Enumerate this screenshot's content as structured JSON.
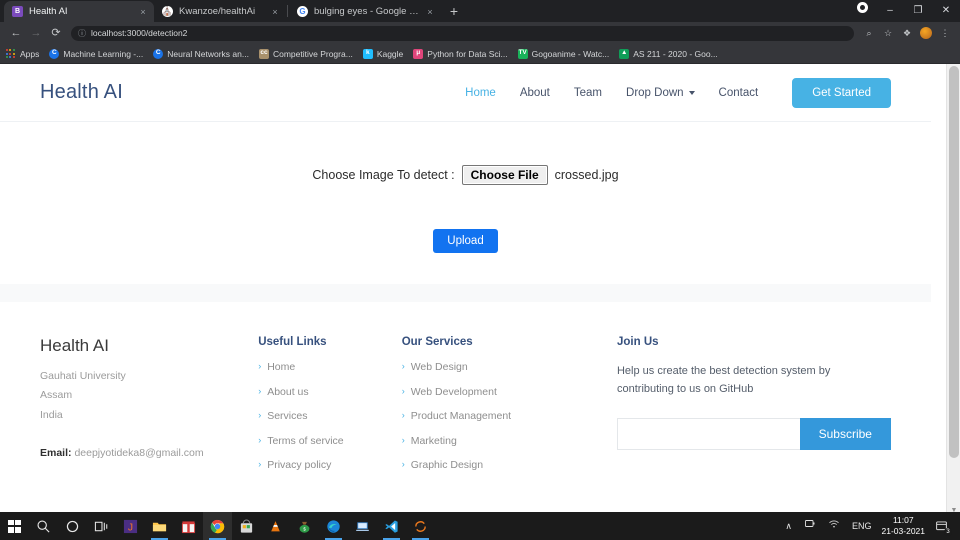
{
  "browser": {
    "tabs": [
      {
        "title": "Health AI",
        "favicon": "bing-icon",
        "active": true,
        "close_label": "×"
      },
      {
        "title": "Kwanzoe/healthAi",
        "favicon": "github-icon",
        "active": false,
        "close_label": "×"
      },
      {
        "title": "bulging eyes - Google Search",
        "favicon": "google-icon",
        "active": false,
        "close_label": "×"
      }
    ],
    "new_tab_label": "+",
    "window_controls": {
      "profile": "●",
      "minimize": "–",
      "maximize": "❐",
      "close": "✕"
    },
    "toolbar": {
      "back": "←",
      "forward": "→",
      "reload": "⟳",
      "url": "localhost:3000/detection2",
      "info_icon": "ⓘ",
      "search_icon": "⌕",
      "bookmark_icon": "☆",
      "extensions_icon": "❖",
      "menu_icon": "⋮"
    },
    "bookmarks": [
      {
        "label": "Apps",
        "icon": "apps-grid-icon"
      },
      {
        "label": "Machine Learning -...",
        "icon": "coursera-icon",
        "letter": "C"
      },
      {
        "label": "Neural Networks an...",
        "icon": "coursera-icon",
        "letter": "C"
      },
      {
        "label": "Competitive Progra...",
        "icon": "codechef-icon",
        "letter": "cc"
      },
      {
        "label": "Kaggle",
        "icon": "kaggle-icon",
        "letter": "k"
      },
      {
        "label": "Python for Data Sci...",
        "icon": "python-icon",
        "letter": "μ"
      },
      {
        "label": "Gogoanime - Watc...",
        "icon": "gogoanime-icon",
        "letter": "TV"
      },
      {
        "label": "AS 211 - 2020 - Goo...",
        "icon": "google-drive-icon",
        "letter": "▲"
      }
    ]
  },
  "site": {
    "brand": "Health AI",
    "nav": [
      {
        "label": "Home",
        "active": true
      },
      {
        "label": "About",
        "active": false
      },
      {
        "label": "Team",
        "active": false
      },
      {
        "label": "Drop Down",
        "active": false,
        "has_caret": true
      },
      {
        "label": "Contact",
        "active": false
      }
    ],
    "cta_label": "Get Started"
  },
  "main": {
    "file_label": "Choose Image To detect :",
    "choose_file_button": "Choose File",
    "file_name": "crossed.jpg",
    "upload_button": "Upload"
  },
  "footer": {
    "brand": "Health AI",
    "address": [
      "Gauhati University",
      "Assam",
      "India"
    ],
    "email_label": "Email:",
    "email_value": "deepjyotideka8@gmail.com",
    "useful_links": {
      "heading": "Useful Links",
      "items": [
        "Home",
        "About us",
        "Services",
        "Terms of service",
        "Privacy policy"
      ]
    },
    "our_services": {
      "heading": "Our Services",
      "items": [
        "Web Design",
        "Web Development",
        "Product Management",
        "Marketing",
        "Graphic Design"
      ]
    },
    "join_us": {
      "heading": "Join Us",
      "text": "Help us create the best detection system by contributing to us on GitHub",
      "input_value": "",
      "input_placeholder": "",
      "subscribe_button": "Subscribe"
    },
    "chevron": "›"
  },
  "taskbar": {
    "start": "windows-logo-icon",
    "items": [
      {
        "name": "search-icon",
        "glyph": "⌕"
      },
      {
        "name": "cortana-icon",
        "glyph": "○"
      },
      {
        "name": "task-view-icon",
        "glyph": "⌸"
      },
      {
        "name": "jupyter-icon",
        "glyph": "⬛",
        "open": false
      },
      {
        "name": "file-explorer-icon",
        "glyph": "὜1",
        "open": true
      },
      {
        "name": "gift-store-icon",
        "glyph": "Ἰ1",
        "open": false
      },
      {
        "name": "chrome-icon",
        "glyph": "◎",
        "open": true,
        "highlight": true
      },
      {
        "name": "microsoft-store-icon",
        "glyph": "Ὤd",
        "open": false
      },
      {
        "name": "vlc-icon",
        "glyph": "△",
        "open": false
      },
      {
        "name": "money-bag-icon",
        "glyph": "Ὃ0",
        "open": false
      },
      {
        "name": "edge-icon",
        "glyph": "◉",
        "open": true
      },
      {
        "name": "remote-desktop-icon",
        "glyph": "Ὃb",
        "open": false
      },
      {
        "name": "vscode-icon",
        "glyph": "⬢",
        "open": true
      },
      {
        "name": "spyder-icon",
        "glyph": "↻",
        "open": true
      }
    ],
    "tray": {
      "chevron_up": "∧",
      "battery_icon": "ὐb",
      "wifi_icon": "◡",
      "language": "ENG",
      "time": "11:07",
      "date": "21-03-2021",
      "notification_count": "3"
    }
  },
  "colors": {
    "accent": "#47b2e4",
    "brand_text": "#37517e",
    "upload_button": "#1273f0",
    "subscribe_button": "#3498db",
    "chrome_bg": "#202124",
    "toolbar_bg": "#35363a"
  }
}
